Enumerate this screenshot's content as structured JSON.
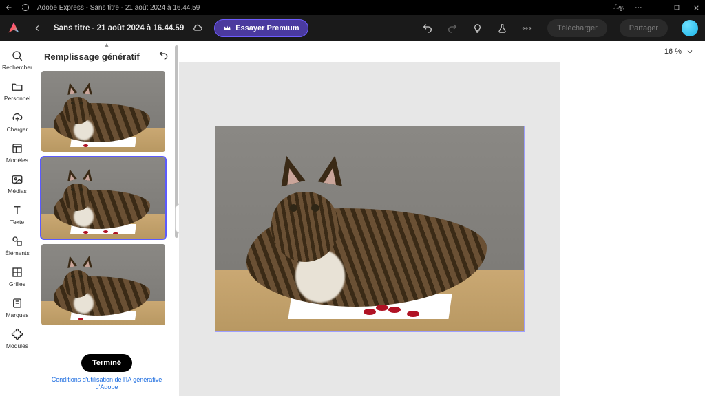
{
  "titlebar": {
    "app_title": "Adobe Express - Sans titre - 21 août 2024 à 16.44.59",
    "lang_badge": "ஃகு"
  },
  "appbar": {
    "doc_title": "Sans titre - 21 août 2024 à 16.44.59",
    "premium_label": "Essayer Premium",
    "download_label": "Télécharger",
    "share_label": "Partager"
  },
  "rail": {
    "items": [
      {
        "label": "Rechercher",
        "icon": "search-icon"
      },
      {
        "label": "Personnel",
        "icon": "folder-icon"
      },
      {
        "label": "Charger",
        "icon": "upload-icon"
      },
      {
        "label": "Modèles",
        "icon": "templates-icon"
      },
      {
        "label": "Médias",
        "icon": "media-icon"
      },
      {
        "label": "Texte",
        "icon": "text-icon"
      },
      {
        "label": "Éléments",
        "icon": "elements-icon"
      },
      {
        "label": "Grilles",
        "icon": "grids-icon"
      },
      {
        "label": "Marques",
        "icon": "brands-icon"
      },
      {
        "label": "Modules",
        "icon": "addons-icon"
      }
    ]
  },
  "panel": {
    "title": "Remplissage génératif",
    "selected_index": 1,
    "thumbnails": [
      "variation-1",
      "variation-2",
      "variation-3"
    ],
    "done_label": "Terminé",
    "tos_label": "Conditions d'utilisation de l'IA générative d'Adobe"
  },
  "canvas": {
    "zoom_label": "16 %"
  }
}
